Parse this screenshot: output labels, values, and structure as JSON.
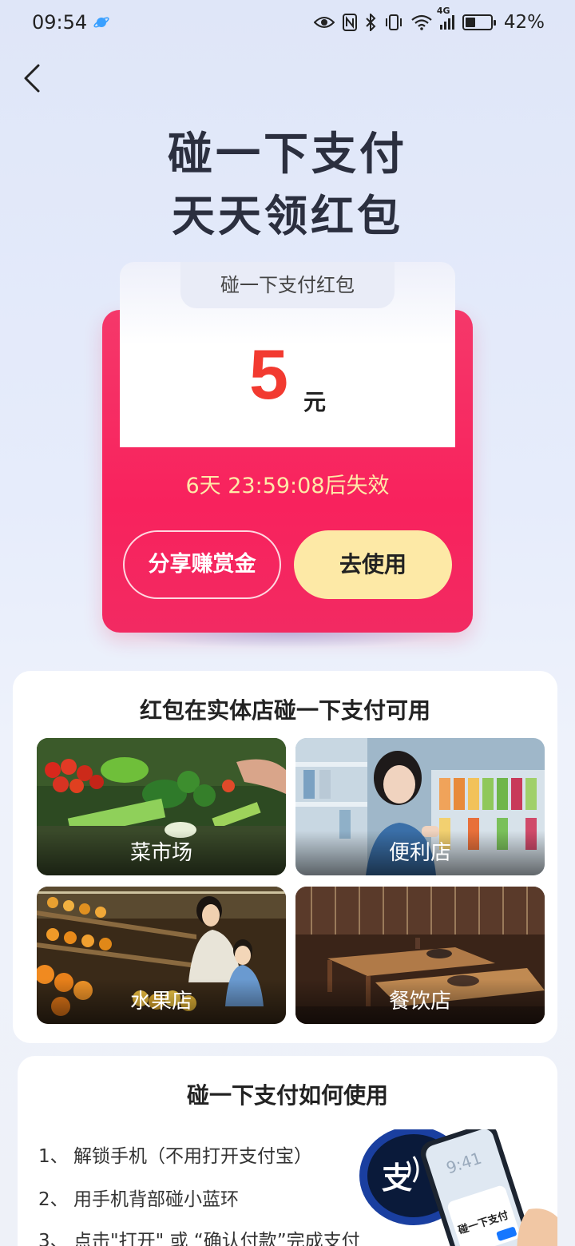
{
  "status_bar": {
    "time": "09:54",
    "network": "4G",
    "battery_level": 0.42,
    "battery_text": "42%"
  },
  "hero": {
    "line1": "碰一下支付",
    "line2": "天天领红包"
  },
  "red_packet": {
    "tab_label": "碰一下支付红包",
    "amount": "5",
    "unit": "元",
    "expiry_text": "6天 23:59:08后失效",
    "share_button": "分享赚赏金",
    "use_button": "去使用"
  },
  "stores": {
    "title": "红包在实体店碰一下支付可用",
    "tiles": [
      {
        "label": "菜市场",
        "icon": "vegetable-market-photo"
      },
      {
        "label": "便利店",
        "icon": "convenience-store-photo"
      },
      {
        "label": "水果店",
        "icon": "fruit-store-photo"
      },
      {
        "label": "餐饮店",
        "icon": "restaurant-photo"
      }
    ]
  },
  "howto": {
    "title": "碰一下支付如何使用",
    "steps": [
      {
        "num": "1、",
        "text": "解锁手机（不用打开支付宝）"
      },
      {
        "num": "2、",
        "text": "用手机背部碰小蓝环"
      },
      {
        "num": "3、",
        "text": "点击\"打开\" 或 “确认付款”完成支付"
      }
    ],
    "illustration_caption": "碰一下支付",
    "phone_time": "9:41",
    "pay_glyph": "支"
  },
  "colors": {
    "envelope": "#f8225d",
    "amount": "#f23a30",
    "use_button": "#fde9a6",
    "expiry": "#ffe9a8"
  }
}
